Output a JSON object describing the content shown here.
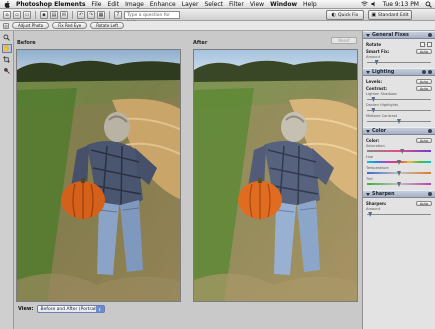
{
  "menubar": {
    "app_name": "Photoshop Elements",
    "items": [
      "File",
      "Edit",
      "Image",
      "Enhance",
      "Layer",
      "Select",
      "Filter",
      "View",
      "Window",
      "Help"
    ],
    "clock": "Tue 9:13 PM"
  },
  "toolbar": {
    "help_placeholder": "Type a question for help",
    "quick_fix_label": "Quick Fix",
    "standard_edit_label": "Standard Edit"
  },
  "options": {
    "auto_smart_fix": "Adjust Photo",
    "red_eye": "Fix Red Eye",
    "rotate": "Rotate Left"
  },
  "work": {
    "before_label": "Before",
    "after_label": "After",
    "reset_label": "Reset",
    "view_label": "View:",
    "view_value": "Before and After (Portrait)"
  },
  "panel": {
    "general_fixes": {
      "title": "General Fixes",
      "rotate_label": "Rotate",
      "smart_fix_label": "Smart Fix:",
      "auto_label": "Auto",
      "amount_label": "Amount",
      "amount_value": 0.15
    },
    "lighting": {
      "title": "Lighting",
      "levels_label": "Levels:",
      "contrast_label": "Contrast:",
      "auto_label": "Auto",
      "lighten_shadows_label": "Lighten Shadows",
      "darken_highlights_label": "Darken Highlights",
      "midtone_contrast_label": "Midtone Contrast",
      "lighten_shadows_value": 0.1,
      "darken_highlights_value": 0.1,
      "midtone_contrast_value": 0.5
    },
    "color": {
      "title": "Color",
      "color_label": "Color:",
      "auto_label": "Auto",
      "saturation_label": "Saturation",
      "hue_label": "Hue",
      "temperature_label": "Temperature",
      "tint_label": "Tint",
      "saturation_value": 0.55,
      "hue_value": 0.5,
      "temperature_value": 0.5,
      "tint_value": 0.5
    },
    "sharpen": {
      "title": "Sharpen",
      "sharpen_label": "Sharpen:",
      "auto_label": "Auto",
      "amount_label": "Amount",
      "amount_value": 0.05
    }
  }
}
